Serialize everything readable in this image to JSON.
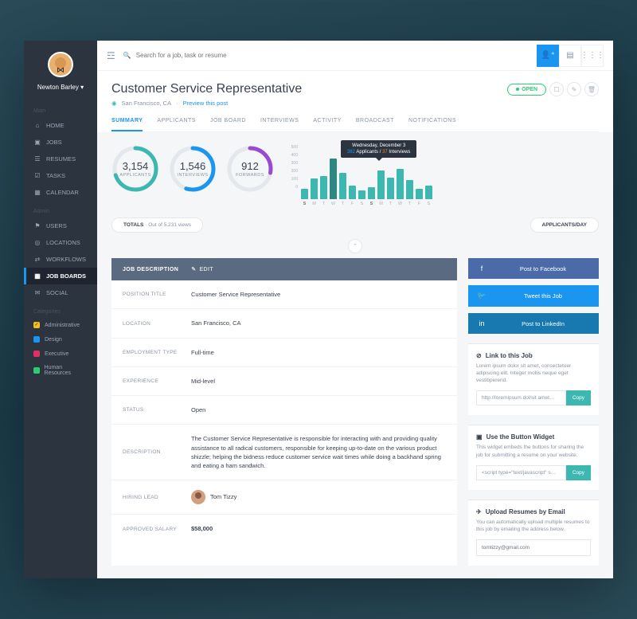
{
  "user": {
    "name": "Newton Barley"
  },
  "search": {
    "placeholder": "Search for a job, task or resume"
  },
  "sidebar": {
    "main_label": "Main",
    "admin_label": "Admin",
    "categories_label": "Categories",
    "main": [
      {
        "icon": "⌂",
        "label": "HOME"
      },
      {
        "icon": "▣",
        "label": "JOBS"
      },
      {
        "icon": "☰",
        "label": "RESUMES"
      },
      {
        "icon": "☑",
        "label": "TASKS"
      },
      {
        "icon": "▦",
        "label": "CALENDAR"
      }
    ],
    "admin": [
      {
        "icon": "⚑",
        "label": "USERS"
      },
      {
        "icon": "◎",
        "label": "LOCATIONS"
      },
      {
        "icon": "⇄",
        "label": "WORKFLOWS"
      },
      {
        "icon": "▦",
        "label": "JOB BOARDS",
        "active": true
      },
      {
        "icon": "✉",
        "label": "SOCIAL"
      }
    ],
    "categories": [
      {
        "color": "#f0c020",
        "label": "Administrative",
        "checked": true
      },
      {
        "color": "#1a96f0",
        "label": "Design"
      },
      {
        "color": "#e03060",
        "label": "Executive"
      },
      {
        "color": "#2ecc71",
        "label": "Human Resources"
      }
    ]
  },
  "header": {
    "title": "Customer Service Representative",
    "location_icon": "◉",
    "location": "San Francisco, CA",
    "sep": "·",
    "preview": "Preview this post",
    "status": "OPEN"
  },
  "tabs": [
    "SUMMARY",
    "APPLICANTS",
    "JOB BOARD",
    "INTERVIEWS",
    "ACTIVITY",
    "BROADCAST",
    "NOTIFICATIONS"
  ],
  "gauges": {
    "applicants": {
      "value": "3,154",
      "label": "APPLICANTS",
      "pct": 70,
      "color": "#3db8b0"
    },
    "interviews": {
      "value": "1,546",
      "label": "INTERVIEWS",
      "pct": 55,
      "color": "#1a96f0"
    },
    "forwards": {
      "value": "912",
      "label": "FORWARDS",
      "pct": 28,
      "color": "#9a4ad0"
    }
  },
  "totals": {
    "label": "TOTALS",
    "sub": "Out of 5,231 views"
  },
  "chart_data": {
    "type": "bar",
    "title": "APPLICANTS/DAY",
    "ylabel": "",
    "xlabel": "",
    "ylim": [
      0,
      500
    ],
    "yticks": [
      500,
      400,
      300,
      200,
      100,
      0
    ],
    "categories": [
      "S",
      "M",
      "T",
      "W",
      "T",
      "F",
      "S",
      "S",
      "M",
      "T",
      "W",
      "T",
      "F",
      "S"
    ],
    "values": [
      120,
      230,
      260,
      460,
      300,
      150,
      100,
      140,
      320,
      240,
      340,
      220,
      120,
      150
    ],
    "highlight_index": 3,
    "tooltip": {
      "date": "Wednesday, December 3",
      "applicants": 382,
      "interviews": 37,
      "app_label": "Applicants",
      "int_label": "Interviews"
    }
  },
  "job_card": {
    "tab_desc": "JOB DESCRIPTION",
    "tab_edit": "EDIT",
    "rows": {
      "position_title": {
        "label": "POSITION TITLE",
        "value": "Customer Service Representative"
      },
      "location": {
        "label": "LOCATION",
        "value": "San Francisco, CA"
      },
      "employment": {
        "label": "EMPLOYMENT TYPE",
        "value": "Full-time"
      },
      "experience": {
        "label": "EXPERIENCE",
        "value": "Mid-level"
      },
      "status": {
        "label": "STATUS",
        "value": "Open"
      },
      "description": {
        "label": "DESCRIPTION",
        "value": "The Customer Service Representative is responsible for interacting with and providing quality assistance to all radical customers, responsible for keeping up-to-date on the various product shizzle; helping the bidness reduce customer service wait times while doing a backhand spring and eating a ham sandwich."
      },
      "hiring_lead": {
        "label": "HIRING LEAD",
        "value": "Tom Tizzy"
      },
      "salary": {
        "label": "APPROVED SALARY",
        "value": "$58,000"
      }
    }
  },
  "share": {
    "fb": "Post to Facebook",
    "tw": "Tweet this Job",
    "li": "Post to LinkedIn"
  },
  "link_section": {
    "title": "Link to this Job",
    "desc": "Lorem ipsum dolor sit amet, consectetuer adipiscing elit. Integer mollis neque eget vestibperend.",
    "url": "http://loremipsum.dol/sit amet…",
    "copy": "Copy"
  },
  "widget_section": {
    "title": "Use the Button Widget",
    "desc": "This widget embeds the buttons for sharing the job for submitting a resume on your website.",
    "code": "<script type=\"text/javascript\" s…",
    "copy": "Copy"
  },
  "email_section": {
    "title": "Upload Resumes by Email",
    "desc": "You can automatically upload multiple resumes to this job by emailing the address below.",
    "email": "tomtizzy@gmail.com"
  }
}
